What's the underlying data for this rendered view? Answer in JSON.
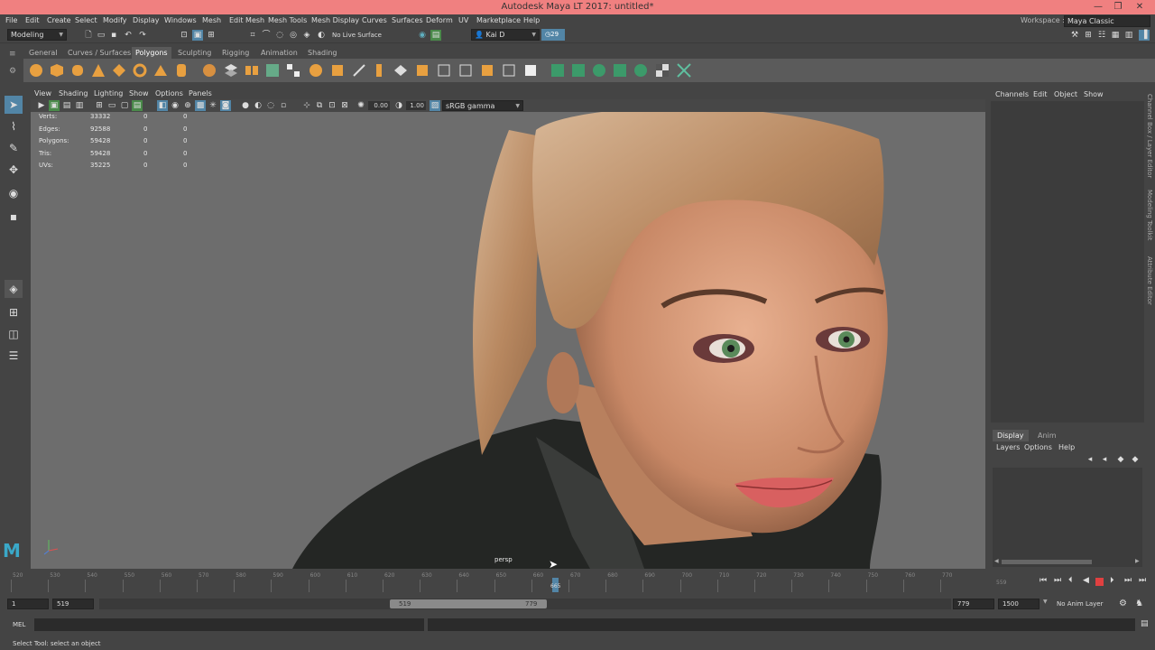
{
  "window": {
    "title": "Autodesk Maya LT 2017: untitled*",
    "controls": [
      "—",
      "❐",
      "✕"
    ]
  },
  "menubar": {
    "items": [
      "File",
      "Edit",
      "Create",
      "Select",
      "Modify",
      "Display",
      "Windows",
      "Mesh",
      "Edit Mesh",
      "Mesh Tools",
      "Mesh Display",
      "Curves",
      "Surfaces",
      "Deform",
      "UV",
      "Marketplace",
      "Help"
    ],
    "workspace_label": "Workspace :",
    "workspace_value": "Maya Classic"
  },
  "statusline": {
    "menuset": "Modeling",
    "live_surface": "No Live Surface",
    "user": "Kai D",
    "notifications": "29"
  },
  "shelf": {
    "tabs": [
      "General",
      "Curves / Surfaces",
      "Polygons",
      "Sculpting",
      "Rigging",
      "Animation",
      "Shading"
    ],
    "active_tab": "Polygons"
  },
  "viewport": {
    "menus": [
      "View",
      "Shading",
      "Lighting",
      "Show",
      "Options",
      "Panels"
    ],
    "exposure": "0.00",
    "gamma": "1.00",
    "color_space": "sRGB gamma",
    "camera_label": "persp",
    "hud": [
      {
        "label": "Verts:",
        "v1": "33332",
        "v2": "0",
        "v3": "0"
      },
      {
        "label": "Edges:",
        "v1": "92588",
        "v2": "0",
        "v3": "0"
      },
      {
        "label": "Polygons:",
        "v1": "59428",
        "v2": "0",
        "v3": "0"
      },
      {
        "label": "Tris:",
        "v1": "59428",
        "v2": "0",
        "v3": "0"
      },
      {
        "label": "UVs:",
        "v1": "35225",
        "v2": "0",
        "v3": "0"
      }
    ]
  },
  "channelbox": {
    "menus": [
      "Channels",
      "Edit",
      "Object",
      "Show"
    ],
    "side_tabs": [
      "Channel Box / Layer Editor",
      "Modeling Toolkit",
      "Attribute Editor"
    ]
  },
  "layereditor": {
    "tabs": [
      "Display",
      "Anim"
    ],
    "active_tab": "Display",
    "menus": [
      "Layers",
      "Options",
      "Help"
    ]
  },
  "timeline": {
    "ticks": [
      "520",
      "530",
      "540",
      "550",
      "560",
      "570",
      "580",
      "590",
      "600",
      "610",
      "620",
      "630",
      "640",
      "650",
      "660",
      "670",
      "680",
      "690",
      "700",
      "710",
      "720",
      "730",
      "740",
      "750",
      "760",
      "770"
    ],
    "current_frame": "665",
    "end_marker": "559"
  },
  "range": {
    "start": "1",
    "range_start": "519",
    "slider_start": "519",
    "slider_end": "779",
    "range_end": "779",
    "end": "1500",
    "anim_layer": "No Anim Layer"
  },
  "mel": {
    "label": "MEL"
  },
  "helpline": {
    "text": "Select Tool: select an object"
  },
  "colors": {
    "titlebar": "#f08080",
    "accent": "#5285a6",
    "ui_bg": "#444444",
    "viewport_bg": "#6d6d6d"
  }
}
